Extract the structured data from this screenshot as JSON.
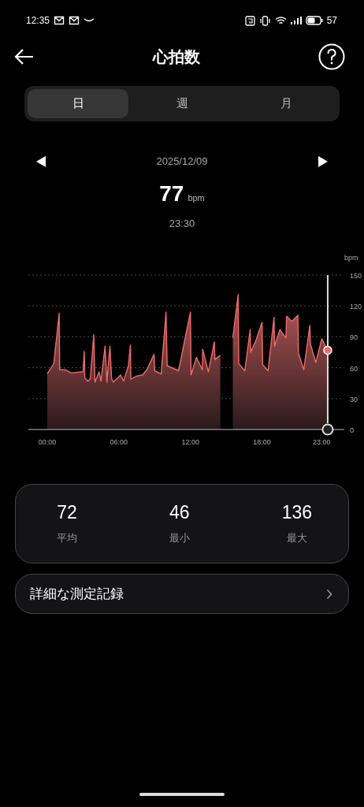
{
  "status_bar": {
    "time": "12:35",
    "battery": "57"
  },
  "header": {
    "title": "心拍数"
  },
  "tabs": [
    {
      "label": "日",
      "selected": true
    },
    {
      "label": "週",
      "selected": false
    },
    {
      "label": "月",
      "selected": false
    }
  ],
  "date_nav": {
    "date": "2025/12/09"
  },
  "reading": {
    "value": "77",
    "unit": "bpm",
    "time": "23:30"
  },
  "chart_data": {
    "type": "area",
    "ylabel": "bpm",
    "xlim": [
      -1.58,
      24.89
    ],
    "ylim": [
      0,
      150
    ],
    "grid": true,
    "ref_lines": [
      {
        "axis": "x",
        "value": 23.5
      }
    ],
    "xticks": [
      {
        "value": 0,
        "label": "00:00"
      },
      {
        "value": 6,
        "label": "06:00"
      },
      {
        "value": 12,
        "label": "12:00"
      },
      {
        "value": 18,
        "label": "18:00"
      },
      {
        "value": 23,
        "label": "23:00"
      }
    ],
    "yticks": [
      0,
      30,
      60,
      90,
      120,
      150
    ],
    "x": [
      0,
      0.55,
      1,
      1.05,
      1.5,
      2,
      3,
      3.1,
      3.15,
      3.4,
      3.6,
      3.9,
      4,
      4.35,
      4.5,
      4.85,
      5,
      5.25,
      5.4,
      5.55,
      6.15,
      6.4,
      6.8,
      6.97,
      7,
      7.5,
      8,
      8.35,
      8.95,
      9,
      9.55,
      9.95,
      10.05,
      11,
      12,
      12.05,
      12.5,
      13,
      13.02,
      13.5,
      14,
      14.05,
      14.5,
      15.55,
      16,
      16.05,
      16.55,
      17,
      17.05,
      17.5,
      18,
      18.05,
      18.5,
      19,
      19.05,
      19.5,
      20,
      20.05,
      20.5,
      21,
      21.05,
      21.5,
      22,
      22.05,
      22.5,
      23,
      23.5
    ],
    "series": [
      {
        "color": "#f06a6a",
        "values": [
          54,
          64,
          113,
          58,
          58,
          55,
          56,
          76,
          50,
          47,
          49,
          92,
          46,
          56,
          47,
          81,
          46,
          81,
          49,
          46,
          53,
          47,
          62,
          82,
          49,
          52,
          53,
          58,
          73,
          57,
          54,
          114,
          62,
          57,
          114,
          53,
          70,
          58,
          78,
          56,
          85,
          68,
          72,
          89,
          131,
          64,
          57,
          97,
          75,
          87,
          104,
          63,
          57,
          109,
          81,
          97,
          89,
          110,
          105,
          111,
          74,
          58,
          101,
          83,
          65,
          88,
          77
        ]
      }
    ]
  },
  "stats": [
    {
      "value": "72",
      "label": "平均"
    },
    {
      "value": "46",
      "label": "最小"
    },
    {
      "value": "136",
      "label": "最大"
    }
  ],
  "detail_link": {
    "label": "詳細な測定記録"
  }
}
